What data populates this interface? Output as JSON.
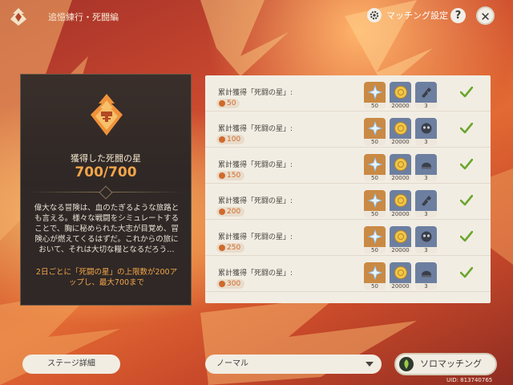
{
  "header": {
    "title": "追憶練行・死闘編",
    "match_settings_label": "マッチング設定",
    "help_label": "?",
    "close_label": "✕"
  },
  "left_panel": {
    "stars_label": "獲得した死闘の星",
    "stars_value": "700/700",
    "description": "偉大なる冒険は、血のたぎるような旅路とも言える。様々な戦闘をシミュレートすることで、胸に秘められた大志が目覚め、冒険心が燃えてくるはずだ。これからの旅において、それは大切な糧となるだろう…",
    "note": "2日ごとに「死闘の星」の上限数が200アップし、最大700まで"
  },
  "rewards": [
    {
      "label": "累計獲得「死闘の星」:",
      "stars": "50",
      "items": [
        {
          "icon": "star-gem-icon",
          "count": "50"
        },
        {
          "icon": "mora-coin-icon",
          "count": "20000"
        },
        {
          "icon": "scroll-icon",
          "count": "3"
        }
      ],
      "claimed": true
    },
    {
      "label": "累計獲得「死闘の星」:",
      "stars": "100",
      "items": [
        {
          "icon": "star-gem-icon",
          "count": "50"
        },
        {
          "icon": "mora-coin-icon",
          "count": "20000"
        },
        {
          "icon": "mask-icon",
          "count": "3"
        }
      ],
      "claimed": true
    },
    {
      "label": "累計獲得「死闘の星」:",
      "stars": "150",
      "items": [
        {
          "icon": "star-gem-icon",
          "count": "50"
        },
        {
          "icon": "mora-coin-icon",
          "count": "20000"
        },
        {
          "icon": "helmet-icon",
          "count": "3"
        }
      ],
      "claimed": true
    },
    {
      "label": "累計獲得「死闘の星」:",
      "stars": "200",
      "items": [
        {
          "icon": "star-gem-icon",
          "count": "50"
        },
        {
          "icon": "mora-coin-icon",
          "count": "20000"
        },
        {
          "icon": "scroll-icon",
          "count": "3"
        }
      ],
      "claimed": true
    },
    {
      "label": "累計獲得「死闘の星」:",
      "stars": "250",
      "items": [
        {
          "icon": "star-gem-icon",
          "count": "50"
        },
        {
          "icon": "mora-coin-icon",
          "count": "20000"
        },
        {
          "icon": "mask-icon",
          "count": "3"
        }
      ],
      "claimed": true
    },
    {
      "label": "累計獲得「死闘の星」:",
      "stars": "300",
      "items": [
        {
          "icon": "star-gem-icon",
          "count": "50"
        },
        {
          "icon": "mora-coin-icon",
          "count": "20000"
        },
        {
          "icon": "helmet-icon",
          "count": "3"
        }
      ],
      "claimed": true
    }
  ],
  "bottom": {
    "stage_details_label": "ステージ詳細",
    "difficulty_value": "ノーマル",
    "solo_match_label": "ソロマッチング",
    "uid": "UID: 813740765"
  },
  "colors": {
    "accent_orange": "#f2a54a",
    "check_green": "#6aa72e",
    "panel_dark": "#2f2826",
    "panel_light": "#f2ede3"
  }
}
